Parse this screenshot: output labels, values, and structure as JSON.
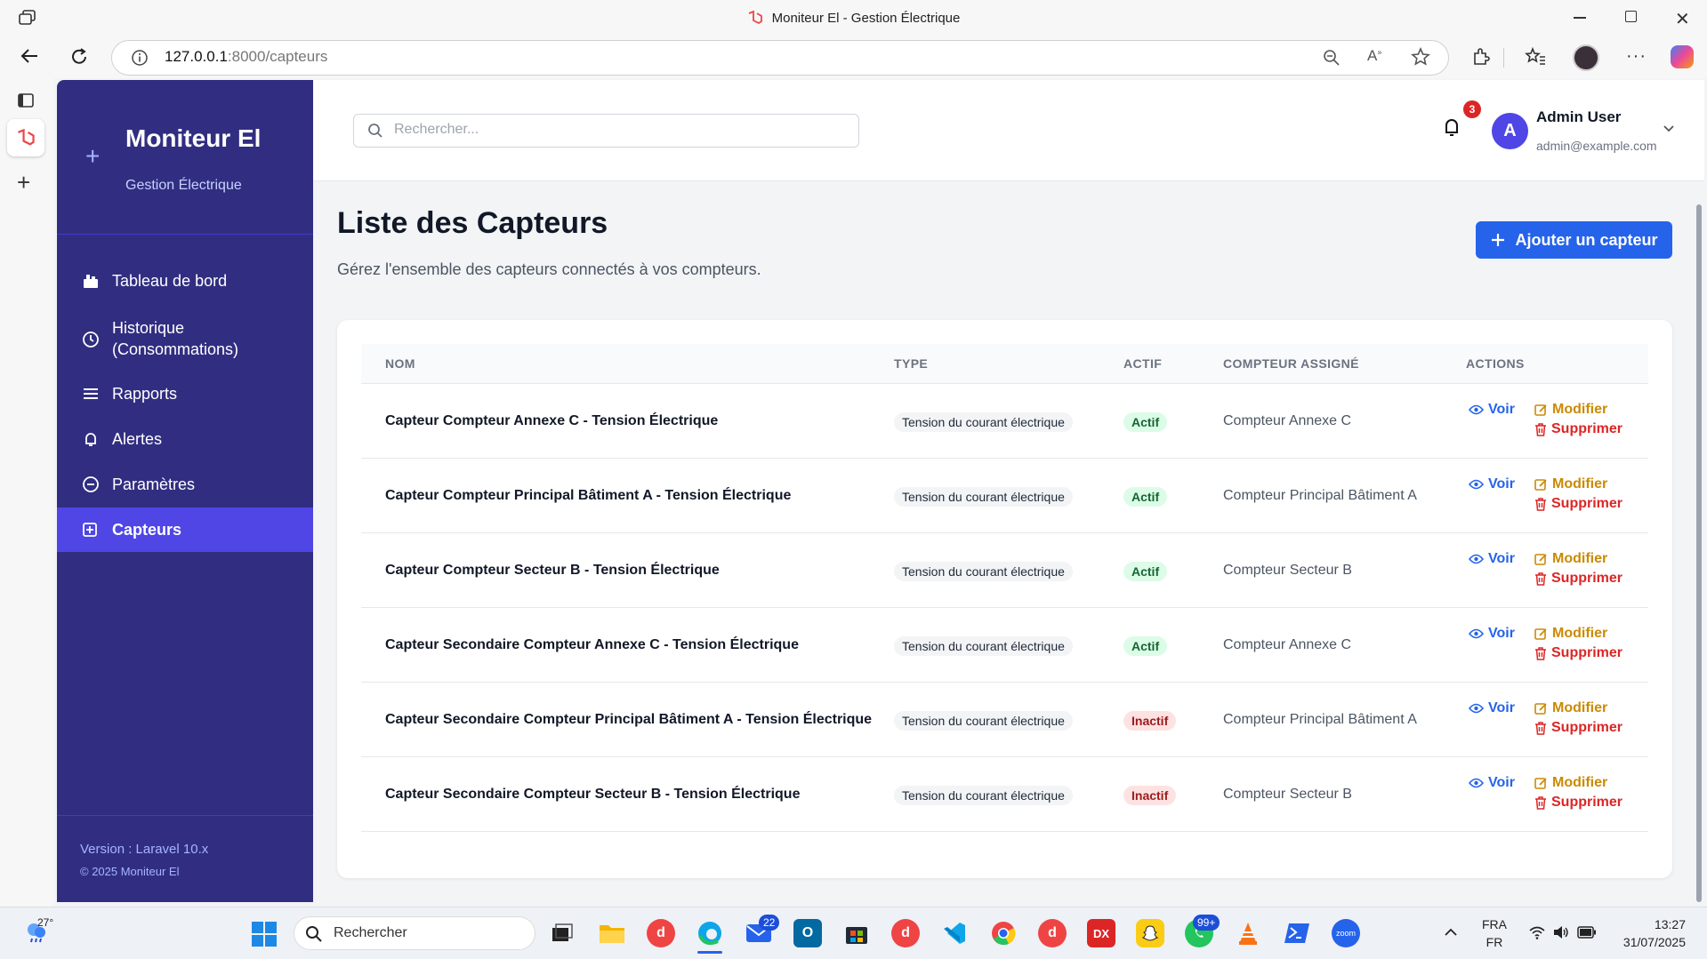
{
  "browser": {
    "window_title": "Moniteur El - Gestion Électrique",
    "url_host": "127.0.0.1",
    "url_path": ":8000/capteurs"
  },
  "sidebar": {
    "brand_title": "Moniteur El",
    "brand_subtitle": "Gestion Électrique",
    "items": [
      {
        "label": "Tableau de bord",
        "icon": "dashboard-icon"
      },
      {
        "label": "Historique",
        "label2": "(Consommations)",
        "icon": "clock-icon"
      },
      {
        "label": "Rapports",
        "icon": "menu-lines-icon"
      },
      {
        "label": "Alertes",
        "icon": "bell-icon"
      },
      {
        "label": "Paramètres",
        "icon": "settings-icon"
      },
      {
        "label": "Capteurs",
        "icon": "sensor-icon",
        "active": true
      }
    ],
    "version": "Version : Laravel 10.x",
    "copyright": "© 2025 Moniteur El"
  },
  "header": {
    "search_placeholder": "Rechercher...",
    "notification_count": "3",
    "avatar_letter": "A",
    "user_name": "Admin User",
    "user_email": "admin@example.com"
  },
  "page": {
    "title": "Liste des Capteurs",
    "subtitle": "Gérez l'ensemble des capteurs connectés à vos compteurs.",
    "add_button": "Ajouter un capteur"
  },
  "table": {
    "columns": [
      "NOM",
      "TYPE",
      "ACTIF",
      "COMPTEUR ASSIGNÉ",
      "ACTIONS"
    ],
    "actions": {
      "view": "Voir",
      "edit": "Modifier",
      "delete": "Supprimer"
    },
    "rows": [
      {
        "name": "Capteur Compteur Annexe C - Tension Électrique",
        "type": "Tension du courant électrique",
        "status": "Actif",
        "meter": "Compteur Annexe C"
      },
      {
        "name": "Capteur Compteur Principal Bâtiment A - Tension Électrique",
        "type": "Tension du courant électrique",
        "status": "Actif",
        "meter": "Compteur Principal Bâtiment A"
      },
      {
        "name": "Capteur Compteur Secteur B - Tension Électrique",
        "type": "Tension du courant électrique",
        "status": "Actif",
        "meter": "Compteur Secteur B"
      },
      {
        "name": "Capteur Secondaire Compteur Annexe C - Tension Électrique",
        "type": "Tension du courant électrique",
        "status": "Actif",
        "meter": "Compteur Annexe C"
      },
      {
        "name": "Capteur Secondaire Compteur Principal Bâtiment A - Tension Électrique",
        "type": "Tension du courant électrique",
        "status": "Inactif",
        "meter": "Compteur Principal Bâtiment A"
      },
      {
        "name": "Capteur Secondaire Compteur Secteur B - Tension Électrique",
        "type": "Tension du courant électrique",
        "status": "Inactif",
        "meter": "Compteur Secteur B"
      }
    ]
  },
  "taskbar": {
    "weather_temp": "27°",
    "search_label": "Rechercher",
    "mail_badge": "22",
    "whatsapp_badge": "99+",
    "lang_top": "FRA",
    "lang_bottom": "FR",
    "time": "13:27",
    "date": "31/07/2025",
    "dx_label": "DX",
    "zoom_label": "zoom"
  },
  "colors": {
    "sidebar_bg": "#312e81",
    "sidebar_active": "#4f46e5",
    "primary": "#2563eb",
    "active_badge_bg": "#dcfce7",
    "inactive_badge_bg": "#fee2e2",
    "edit": "#ca8a04",
    "delete": "#dc2626"
  }
}
